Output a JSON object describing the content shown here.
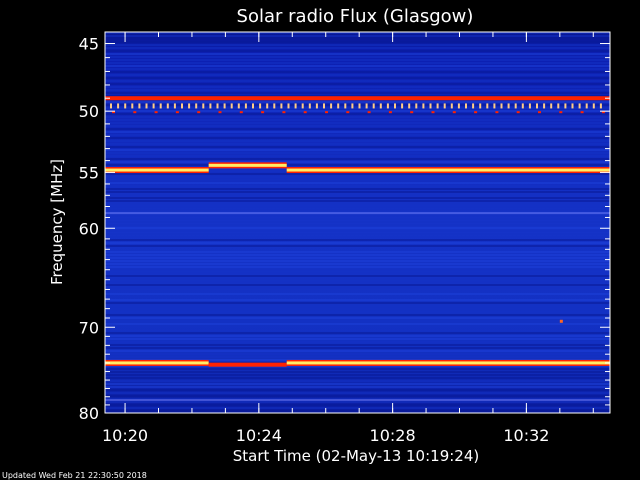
{
  "chart_data": {
    "type": "heatmap",
    "title": "Solar radio Flux (Glasgow)",
    "xlabel": "Start Time (02-May-13 10:19:24)",
    "ylabel": "Frequency [MHz]",
    "footer": "Updated Wed Feb 21 22:30:50 2018",
    "x_unit": "minutes",
    "x_range": [
      "10:19:24",
      "10:34:30"
    ],
    "y_range_mhz": [
      44.2,
      80.0
    ],
    "y_axis_scale": "log",
    "x_ticks": [
      {
        "label": "10:20",
        "time": "10:20:00"
      },
      {
        "label": "10:24",
        "time": "10:24:00"
      },
      {
        "label": "10:28",
        "time": "10:28:00"
      },
      {
        "label": "10:32",
        "time": "10:32:00"
      }
    ],
    "y_ticks": [
      {
        "label": "45",
        "value": 45
      },
      {
        "label": "50",
        "value": 50
      },
      {
        "label": "55",
        "value": 55
      },
      {
        "label": "60",
        "value": 60
      },
      {
        "label": "70",
        "value": 70
      },
      {
        "label": "80",
        "value": 80
      }
    ],
    "colors": {
      "background_low": "#0a1aa8",
      "background_mid": "#1630c8",
      "emission_red": "#ff2200",
      "emission_yellow": "#ffee66",
      "emission_white": "#ffffff"
    },
    "interference_lines_mhz": [
      {
        "freq": 49.0,
        "from": "10:19:24",
        "to": "10:34:30",
        "color": "red"
      },
      {
        "freq": 54.8,
        "from": "10:19:24",
        "to": "10:22:30",
        "color": "yellow"
      },
      {
        "freq": 54.4,
        "from": "10:22:30",
        "to": "10:24:50",
        "color": "yellow"
      },
      {
        "freq": 54.8,
        "from": "10:24:50",
        "to": "10:34:30",
        "color": "yellow"
      },
      {
        "freq": 74.0,
        "from": "10:19:24",
        "to": "10:22:30",
        "color": "yellow"
      },
      {
        "freq": 74.2,
        "from": "10:22:30",
        "to": "10:24:50",
        "color": "red"
      },
      {
        "freq": 74.0,
        "from": "10:24:50",
        "to": "10:34:30",
        "color": "yellow"
      },
      {
        "freq": 58.6,
        "from": "10:19:24",
        "to": "10:34:30",
        "color": "faint"
      },
      {
        "freq": 78.4,
        "from": "10:19:24",
        "to": "10:34:30",
        "color": "faint"
      }
    ]
  }
}
